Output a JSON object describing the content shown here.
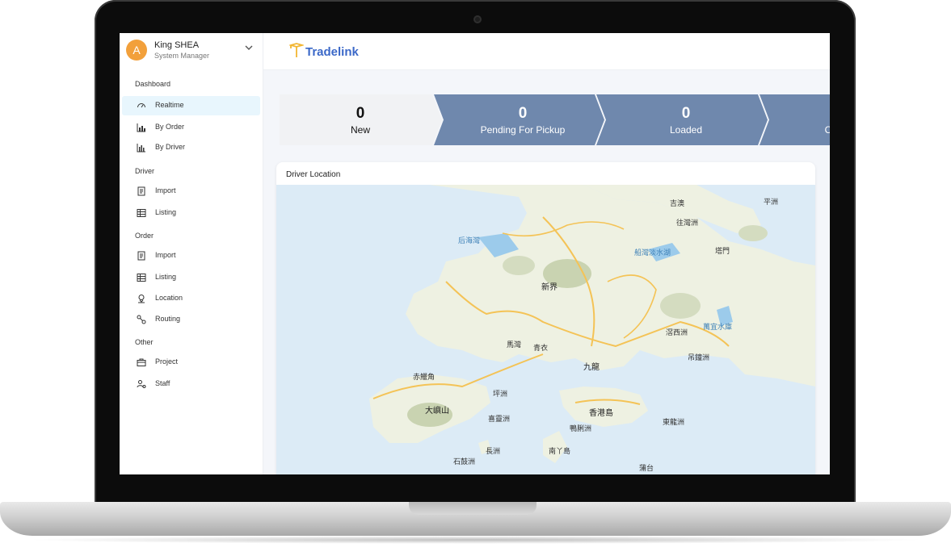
{
  "user": {
    "avatar_letter": "A",
    "name": "King SHEA",
    "role": "System Manager"
  },
  "sidebar": {
    "sections": [
      {
        "title": "Dashboard",
        "items": [
          {
            "label": "Realtime",
            "icon": "gauge-icon",
            "active": true
          },
          {
            "label": "By Order",
            "icon": "bar-chart-icon"
          },
          {
            "label": "By Driver",
            "icon": "column-chart-icon"
          }
        ]
      },
      {
        "title": "Driver",
        "items": [
          {
            "label": "Import",
            "icon": "import-icon"
          },
          {
            "label": "Listing",
            "icon": "table-icon"
          }
        ]
      },
      {
        "title": "Order",
        "items": [
          {
            "label": "Import",
            "icon": "import-icon"
          },
          {
            "label": "Listing",
            "icon": "table-icon"
          },
          {
            "label": "Location",
            "icon": "location-pin-icon"
          },
          {
            "label": "Routing",
            "icon": "route-icon"
          }
        ]
      },
      {
        "title": "Other",
        "items": [
          {
            "label": "Project",
            "icon": "briefcase-icon"
          },
          {
            "label": "Staff",
            "icon": "staff-settings-icon"
          }
        ]
      }
    ]
  },
  "header": {
    "logo_text": "Tradelink",
    "logo_color": "#3b68c8",
    "logo_mark_color": "#f2b632"
  },
  "status_steps": [
    {
      "count": "0",
      "label": "New",
      "active": true
    },
    {
      "count": "0",
      "label": "Pending For Pickup"
    },
    {
      "count": "0",
      "label": "Loaded"
    },
    {
      "count": "",
      "label": "C"
    }
  ],
  "colors": {
    "step_active_bg": "#f1f2f4",
    "step_bg": "#6f88ad",
    "accent_avatar": "#f2a03b"
  },
  "map": {
    "title": "Driver Location",
    "places": [
      {
        "name": "吉澳"
      },
      {
        "name": "平洲"
      },
      {
        "name": "往灣洲"
      },
      {
        "name": "后海灣"
      },
      {
        "name": "船灣淡水湖"
      },
      {
        "name": "塔門"
      },
      {
        "name": "新界"
      },
      {
        "name": "滘西洲"
      },
      {
        "name": "萬宜水庫"
      },
      {
        "name": "馬灣"
      },
      {
        "name": "青衣"
      },
      {
        "name": "九龍"
      },
      {
        "name": "吊鐘洲"
      },
      {
        "name": "赤鱲角"
      },
      {
        "name": "坪洲"
      },
      {
        "name": "大嶼山"
      },
      {
        "name": "香港島"
      },
      {
        "name": "喜靈洲"
      },
      {
        "name": "東龍洲"
      },
      {
        "name": "鴨脷洲"
      },
      {
        "name": "長洲"
      },
      {
        "name": "南丫島"
      },
      {
        "name": "石鼓洲"
      },
      {
        "name": "蒲台"
      }
    ]
  }
}
